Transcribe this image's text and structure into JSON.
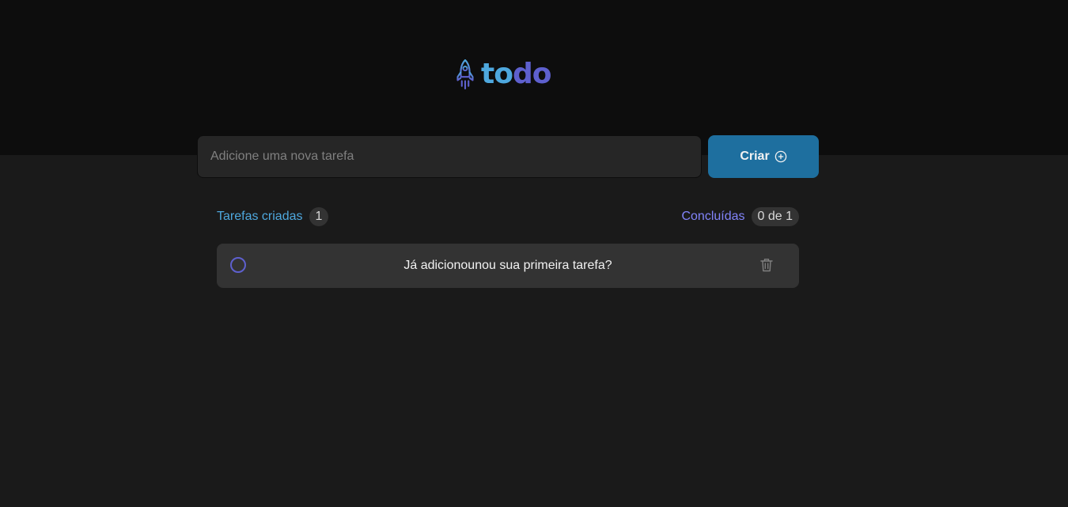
{
  "header": {
    "logo_part1": "to",
    "logo_part2": "do",
    "logo_icon": "rocket-icon"
  },
  "new_task": {
    "placeholder": "Adicione uma nova tarefa",
    "value": "",
    "create_label": "Criar",
    "create_icon": "plus-circle-icon"
  },
  "info": {
    "created_label": "Tarefas criadas",
    "created_count": "1",
    "done_label": "Concluídas",
    "done_count": "0 de 1"
  },
  "tasks": [
    {
      "text": "Já adicionounou sua primeira tarefa?",
      "completed": false,
      "delete_icon": "trash-icon"
    }
  ],
  "colors": {
    "header_bg": "#0d0d0d",
    "page_bg": "#1a1a1a",
    "input_bg": "#262626",
    "card_bg": "#333333",
    "blue": "#4ea8de",
    "blue_dark": "#1e6f9f",
    "purple": "#5e60ce",
    "purple_light": "#8284fa"
  }
}
